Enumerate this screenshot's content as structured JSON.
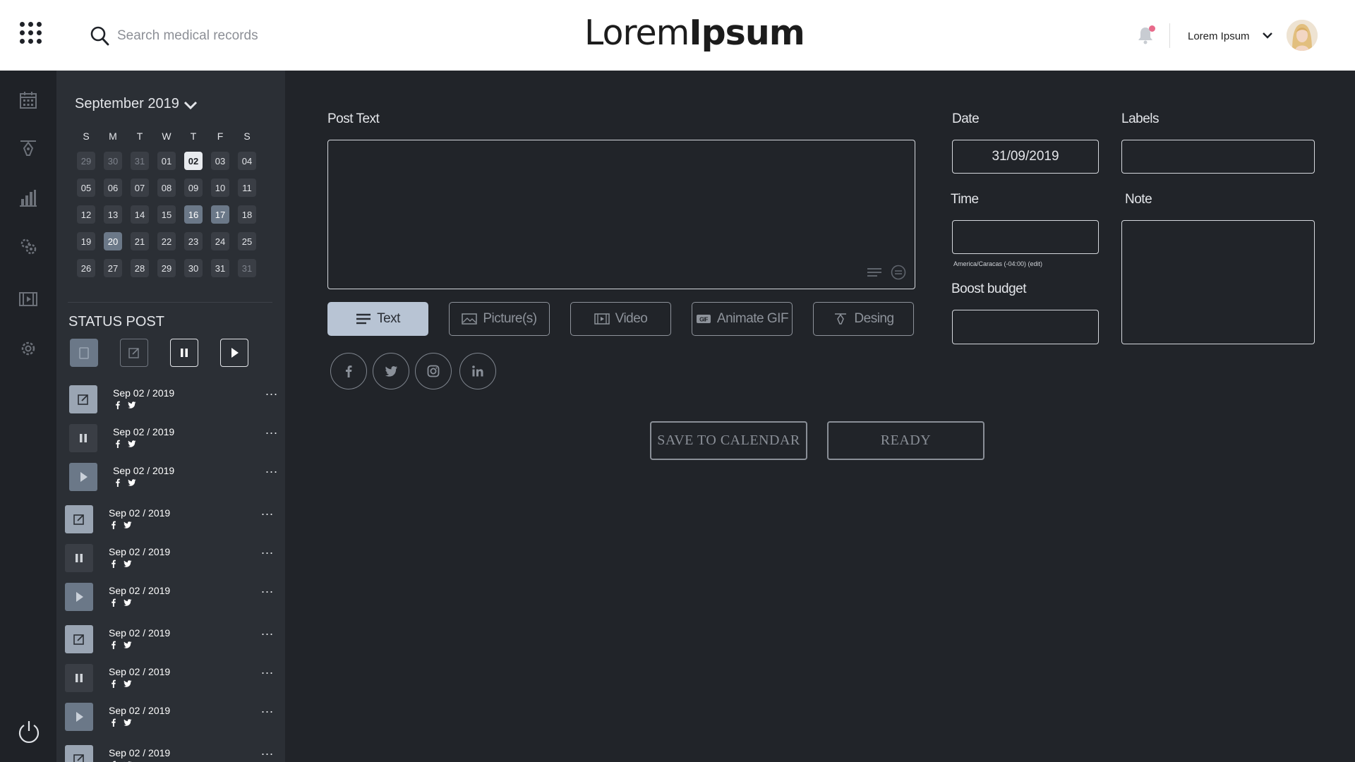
{
  "header": {
    "search_placeholder": "Search medical records",
    "logo_light": "Lorem",
    "logo_bold": "Ipsum",
    "user_name": "Lorem Ipsum"
  },
  "rail": {
    "icons": [
      "calendar-icon",
      "pen-tool-icon",
      "bar-chart-icon",
      "gear-cluster-icon",
      "film-icon",
      "settings-icon",
      "power-icon"
    ]
  },
  "calendar": {
    "month": "September 2019",
    "weekdays": [
      "S",
      "M",
      "T",
      "W",
      "T",
      "F",
      "S"
    ],
    "weeks": [
      [
        "29",
        "30",
        "31",
        "01",
        "02",
        "03",
        "04"
      ],
      [
        "05",
        "06",
        "07",
        "08",
        "09",
        "10",
        "11"
      ],
      [
        "12",
        "13",
        "14",
        "15",
        "16",
        "17",
        "18"
      ],
      [
        "19",
        "20",
        "21",
        "22",
        "23",
        "24",
        "25"
      ],
      [
        "26",
        "27",
        "28",
        "29",
        "30",
        "31",
        "31"
      ]
    ]
  },
  "status": {
    "title": "STATUS POST",
    "posts": [
      {
        "date": "Sep 02 / 2019",
        "status": "edit",
        "more": "..."
      },
      {
        "date": "Sep 02 / 2019",
        "status": "pause",
        "more": "..."
      },
      {
        "date": "Sep 02 / 2019",
        "status": "play",
        "more": "..."
      },
      {
        "date": "Sep 02 / 2019",
        "status": "edit",
        "more": "..."
      },
      {
        "date": "Sep 02 / 2019",
        "status": "pause",
        "more": "..."
      },
      {
        "date": "Sep 02 / 2019",
        "status": "play",
        "more": "..."
      },
      {
        "date": "Sep 02 / 2019",
        "status": "edit",
        "more": "..."
      },
      {
        "date": "Sep 02 / 2019",
        "status": "pause",
        "more": "..."
      },
      {
        "date": "Sep 02 / 2019",
        "status": "play",
        "more": "..."
      },
      {
        "date": "Sep 02 / 2019",
        "status": "edit",
        "more": "..."
      }
    ]
  },
  "editor": {
    "post_text_label": "Post Text",
    "types": [
      "Text",
      "Picture(s)",
      "Video",
      "Animate GIF",
      "Desing"
    ],
    "save_label": "SAVE TO  CALENDAR",
    "ready_label": "READY"
  },
  "fields": {
    "date_label": "Date",
    "date_value": "31/09/2019",
    "labels_label": "Labels",
    "time_label": "Time",
    "timezone_note": "America/Caracas (-04:00) (edit)",
    "note_label": "Note",
    "boost_label": "Boost budget"
  },
  "colors": {
    "background": "#212429",
    "panel": "#2b2f35",
    "accent": "#b8c4d4",
    "selected_day": "#6b7888",
    "notification": "#e86a8a"
  }
}
